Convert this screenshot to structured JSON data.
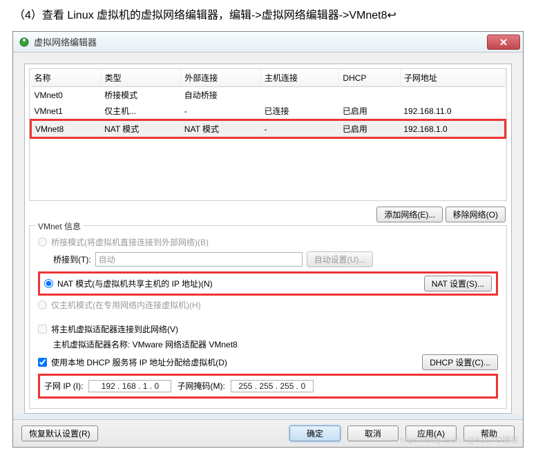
{
  "caption": "（4）查看 Linux 虚拟机的虚拟网络编辑器，编辑->虚拟网络编辑器->VMnet8↩",
  "window": {
    "title": "虚拟网络编辑器"
  },
  "table": {
    "cols": [
      "名称",
      "类型",
      "外部连接",
      "主机连接",
      "DHCP",
      "子网地址"
    ],
    "rows": [
      {
        "name": "VMnet0",
        "type": "桥接模式",
        "ext": "自动桥接",
        "host": "",
        "dhcp": "",
        "subnet": ""
      },
      {
        "name": "VMnet1",
        "type": "仅主机...",
        "ext": "-",
        "host": "已连接",
        "dhcp": "已启用",
        "subnet": "192.168.11.0"
      },
      {
        "name": "VMnet8",
        "type": "NAT 模式",
        "ext": "NAT 模式",
        "host": "-",
        "dhcp": "已启用",
        "subnet": "192.168.1.0"
      }
    ],
    "btn_add": "添加网络(E)...",
    "btn_del": "移除网络(O)"
  },
  "info": {
    "legend": "VMnet 信息",
    "bridge": "桥接模式(将虚拟机直接连接到外部网络)(B)",
    "bridge_to": "桥接到(T):",
    "bridge_val": "自动",
    "bridge_btn": "自动设置(U)...",
    "nat": "NAT 模式(与虚拟机共享主机的 IP 地址)(N)",
    "nat_btn": "NAT 设置(S)...",
    "hostonly": "仅主机模式(在专用网络内连接虚拟机)(H)",
    "connect": "将主机虚拟适配器连接到此网络(V)",
    "adapter_lbl": "主机虚拟适配器名称: VMware 网络适配器 VMnet8",
    "dhcp": "使用本地 DHCP 服务将 IP 地址分配给虚拟机(D)",
    "dhcp_btn": "DHCP 设置(C)...",
    "subnet_lbl": "子网 IP (I):",
    "subnet_val": "192 . 168 .  1  .  0",
    "mask_lbl": "子网掩码(M):",
    "mask_val": "255 . 255 . 255 .  0"
  },
  "footer": {
    "restore": "恢复默认设置(R)",
    "ok": "确定",
    "cancel": "取消",
    "apply": "应用(A)",
    "help": "帮助"
  },
  "watermark": "https://blog.csdn.n@51CTO博客"
}
